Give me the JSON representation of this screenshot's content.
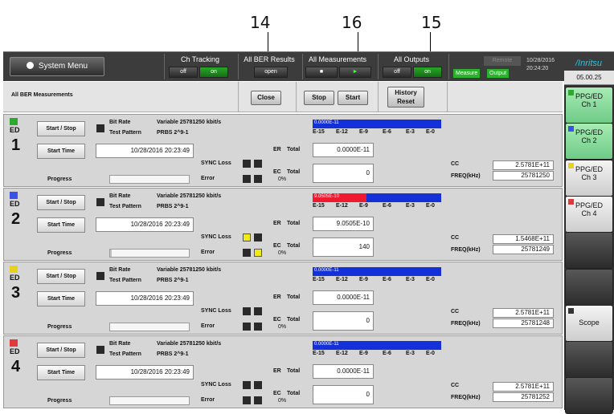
{
  "callouts": [
    "14",
    "16",
    "15"
  ],
  "topbar": {
    "system_menu": "System Menu",
    "ch_tracking": {
      "title": "Ch Tracking",
      "off": "off",
      "on": "on"
    },
    "all_ber_results": {
      "title": "All BER Results",
      "open": "open"
    },
    "all_measurements": {
      "title": "All Measurements",
      "stop": "■",
      "start": "►"
    },
    "all_outputs": {
      "title": "All Outputs",
      "off": "off",
      "on": "on"
    },
    "remote": "Remote",
    "measure": "Measure",
    "output": "Output",
    "date": "10/28/2016",
    "time": "20:24:20",
    "logo": "/Inritsu"
  },
  "header": {
    "title": "All BER Measurements",
    "close": "Close",
    "stop": "Stop",
    "start": "Start",
    "history_reset": "History Reset"
  },
  "labels": {
    "start_stop": "Start / Stop",
    "start_time": "Start Time",
    "progress": "Progress",
    "bit_rate": "Bit Rate",
    "test_pattern": "Test Pattern",
    "sync_loss": "SYNC Loss",
    "error": "Error",
    "er": "ER",
    "ec": "EC",
    "total": "Total",
    "cc": "CC",
    "freq": "FREQ(kHz)",
    "scale": [
      "E-15",
      "E-12",
      "E-9",
      "E-6",
      "E-3",
      "E-0"
    ],
    "ed": "ED"
  },
  "channels": [
    {
      "num": "1",
      "bit_rate": "Variable 25781250 kbit/s",
      "pattern": "PRBS 2^9-1",
      "start_time": "10/28/2016 20:23:49",
      "progress_pct": "0%",
      "progress": 0.0,
      "bar_label": "0.0000E-11",
      "red_fraction": 0.0,
      "er": "0.0000E-11",
      "ec": "0",
      "cc": "2.5781E+11",
      "freq": "25781250",
      "sync_yellow": false,
      "error_yellow": false,
      "icon_color": "#2ea82e"
    },
    {
      "num": "2",
      "bit_rate": "Variable 25781250 kbit/s",
      "pattern": "PRBS 2^9-1",
      "start_time": "10/28/2016 20:23:49",
      "progress_pct": "0%",
      "progress": 0.02,
      "bar_label": "9.0505E-10",
      "red_fraction": 0.42,
      "er": "9.0505E-10",
      "ec": "140",
      "cc": "1.5468E+11",
      "freq": "25781249",
      "sync_yellow": true,
      "error_yellow": true,
      "icon_color": "#3a52e8"
    },
    {
      "num": "3",
      "bit_rate": "Variable 25781250 kbit/s",
      "pattern": "PRBS 2^9-1",
      "start_time": "10/28/2016 20:23:49",
      "progress_pct": "0%",
      "progress": 0.0,
      "bar_label": "0.0000E-11",
      "red_fraction": 0.0,
      "er": "0.0000E-11",
      "ec": "0",
      "cc": "2.5781E+11",
      "freq": "25781248",
      "sync_yellow": false,
      "error_yellow": false,
      "icon_color": "#e8d21a"
    },
    {
      "num": "4",
      "bit_rate": "Variable 25781250 kbit/s",
      "pattern": "PRBS 2^9-1",
      "start_time": "10/28/2016 20:23:49",
      "progress_pct": "0%",
      "progress": 0.0,
      "bar_label": "0.0000E-11",
      "red_fraction": 0.0,
      "er": "0.0000E-11",
      "ec": "0",
      "cc": "2.5781E+11",
      "freq": "25781252",
      "sync_yellow": false,
      "error_yellow": false,
      "icon_color": "#e23a3a"
    }
  ],
  "sidebar": {
    "version": "05.00.25",
    "buttons": [
      {
        "l1": "PPG/ED",
        "l2": "Ch 1",
        "style": "act",
        "icon": "#2ea82e"
      },
      {
        "l1": "PPG/ED",
        "l2": "Ch 2",
        "style": "act",
        "icon": "#3a52e8"
      },
      {
        "l1": "PPG/ED",
        "l2": "Ch 3",
        "style": "norm",
        "icon": "#e8d21a"
      },
      {
        "l1": "PPG/ED",
        "l2": "Ch 4",
        "style": "norm",
        "icon": "#e23a3a"
      },
      {
        "l1": "",
        "l2": "",
        "style": "empty",
        "icon": ""
      },
      {
        "l1": "",
        "l2": "",
        "style": "empty",
        "icon": ""
      },
      {
        "l1": "Scope",
        "l2": "",
        "style": "norm",
        "icon": "#333"
      },
      {
        "l1": "",
        "l2": "",
        "style": "empty",
        "icon": ""
      },
      {
        "l1": "",
        "l2": "",
        "style": "empty",
        "icon": ""
      }
    ]
  }
}
